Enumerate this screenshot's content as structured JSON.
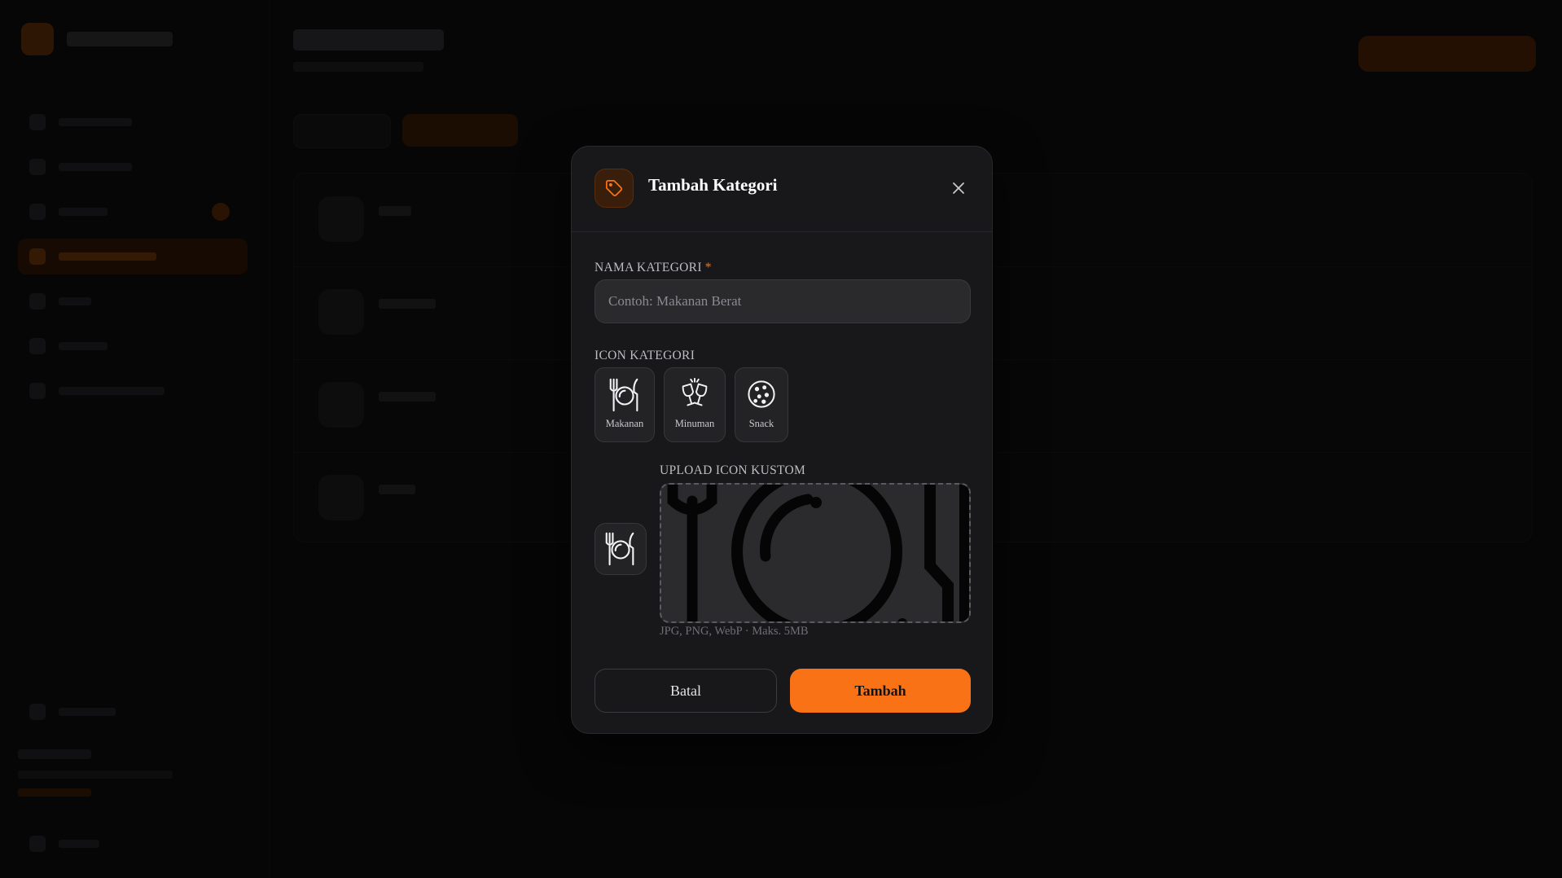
{
  "modal": {
    "title": "Tambah Kategori",
    "header_icon": "tag-icon",
    "close_icon": "close-icon",
    "name_field": {
      "label": "NAMA KATEGORI",
      "required_mark": "*",
      "value": "",
      "placeholder": "Contoh: Makanan Berat"
    },
    "icon_section": {
      "label": "ICON KATEGORI",
      "options": [
        {
          "label": "Makanan",
          "icon": "plate-cutlery-icon"
        },
        {
          "label": "Minuman",
          "icon": "toast-glasses-icon"
        },
        {
          "label": "Snack",
          "icon": "cookie-icon"
        }
      ]
    },
    "upload": {
      "label": "UPLOAD ICON KUSTOM",
      "hint": "JPG, PNG, WebP · Maks. 5MB",
      "preview_icon": "plate-cutlery-icon"
    },
    "buttons": {
      "cancel": "Batal",
      "submit": "Tambah"
    }
  },
  "colors": {
    "accent": "#f97316",
    "modal_bg": "#18181a",
    "input_bg": "#2a2a2d"
  }
}
